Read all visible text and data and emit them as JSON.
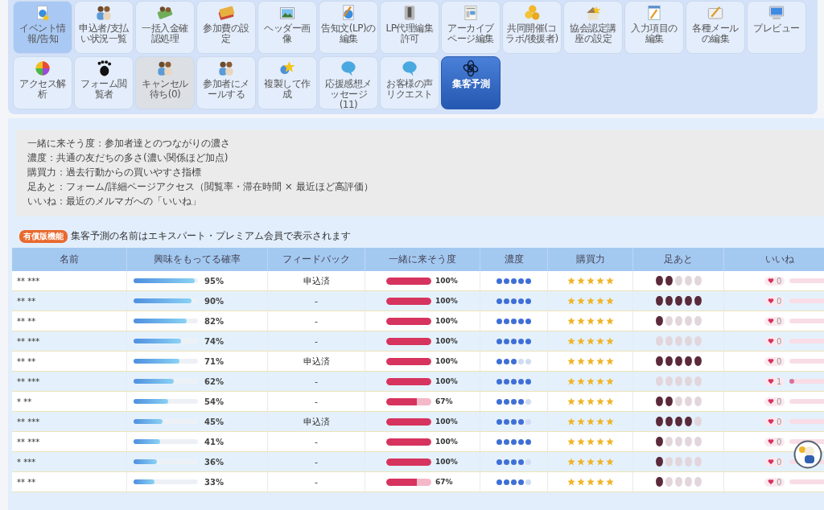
{
  "toolbar": [
    {
      "label": "イベント情報/告知",
      "highlighted": true,
      "selected": false,
      "disabled": false
    },
    {
      "label": "申込者/支払い状況一覧",
      "highlighted": false,
      "selected": false,
      "disabled": false
    },
    {
      "label": "一括入金確認処理",
      "highlighted": false,
      "selected": false,
      "disabled": false
    },
    {
      "label": "参加費の設定",
      "highlighted": false,
      "selected": false,
      "disabled": false
    },
    {
      "label": "ヘッダー画像",
      "highlighted": false,
      "selected": false,
      "disabled": false
    },
    {
      "label": "告知文(LP)の編集",
      "highlighted": false,
      "selected": false,
      "disabled": false
    },
    {
      "label": "LP代理編集許可",
      "highlighted": false,
      "selected": false,
      "disabled": false
    },
    {
      "label": "アーカイブページ編集",
      "highlighted": false,
      "selected": false,
      "disabled": false
    },
    {
      "label": "共同開催(コラボ/後援者)",
      "highlighted": false,
      "selected": false,
      "disabled": false
    },
    {
      "label": "協会認定講座の設定",
      "highlighted": false,
      "selected": false,
      "disabled": false
    },
    {
      "label": "入力項目の編集",
      "highlighted": false,
      "selected": false,
      "disabled": false
    },
    {
      "label": "各種メールの編集",
      "highlighted": false,
      "selected": false,
      "disabled": false
    },
    {
      "label": "プレビュー",
      "highlighted": false,
      "selected": false,
      "disabled": false
    },
    {
      "label": "アクセス解析",
      "highlighted": false,
      "selected": false,
      "disabled": false
    },
    {
      "label": "フォーム閲覧者",
      "highlighted": false,
      "selected": false,
      "disabled": false
    },
    {
      "label": "キャンセル待ち(0)",
      "highlighted": false,
      "selected": false,
      "disabled": true
    },
    {
      "label": "参加者にメールする",
      "highlighted": false,
      "selected": false,
      "disabled": false
    },
    {
      "label": "複製して作成",
      "highlighted": false,
      "selected": false,
      "disabled": false
    },
    {
      "label": "応援感想メッセージ(11)",
      "highlighted": false,
      "selected": false,
      "disabled": false
    },
    {
      "label": "お客様の声リクエスト",
      "highlighted": false,
      "selected": false,
      "disabled": false
    },
    {
      "label": "集客予測",
      "highlighted": false,
      "selected": true,
      "disabled": false
    }
  ],
  "legend": [
    "一緒に来そう度：参加者達とのつながりの濃さ",
    "濃度：共通の友だちの多さ(濃い関係ほど加点)",
    "購買力：過去行動からの買いやすさ指標",
    "足あと：フォーム/詳細ページアクセス（閲覧率・滞在時間 × 最近ほど高評価）",
    "いいね：最近のメルマガへの「いいね」"
  ],
  "notice": {
    "badge": "有償版機能",
    "text": "集客予測の名前はエキスパート・プレミアム会員で表示されます"
  },
  "table": {
    "columns": [
      "名前",
      "興味をもってる確率",
      "フィードバック",
      "一緒に来そう度",
      "濃度",
      "購買力",
      "足あと",
      "いいね"
    ],
    "rows": [
      {
        "name": "** ***",
        "interest": {
          "level": 0.95,
          "text": "95%"
        },
        "feedback": "申込済",
        "together": {
          "level": 1,
          "text": "100%"
        },
        "density": {
          "stars": 5
        },
        "purchase": {
          "stars": 5
        },
        "footprints": {
          "stars": 2
        },
        "likes": {
          "count": "0",
          "level": 0
        }
      },
      {
        "name": "** **",
        "interest": {
          "level": 0.9,
          "text": "90%"
        },
        "feedback": "-",
        "together": {
          "level": 1,
          "text": "100%"
        },
        "density": {
          "stars": 5
        },
        "purchase": {
          "stars": 5
        },
        "footprints": {
          "stars": 5
        },
        "likes": {
          "count": "0",
          "level": 0
        }
      },
      {
        "name": "** **",
        "interest": {
          "level": 0.82,
          "text": "82%"
        },
        "feedback": "-",
        "together": {
          "level": 1,
          "text": "100%"
        },
        "density": {
          "stars": 5
        },
        "purchase": {
          "stars": 5
        },
        "footprints": {
          "stars": 1
        },
        "likes": {
          "count": "0",
          "level": 0
        }
      },
      {
        "name": "** ***",
        "interest": {
          "level": 0.74,
          "text": "74%"
        },
        "feedback": "-",
        "together": {
          "level": 1,
          "text": "100%"
        },
        "density": {
          "stars": 5
        },
        "purchase": {
          "stars": 5
        },
        "footprints": {
          "stars": 0
        },
        "likes": {
          "count": "0",
          "level": 0
        }
      },
      {
        "name": "** **",
        "interest": {
          "level": 0.71,
          "text": "71%"
        },
        "feedback": "申込済",
        "together": {
          "level": 1,
          "text": "100%"
        },
        "density": {
          "stars": 3
        },
        "purchase": {
          "stars": 5
        },
        "footprints": {
          "stars": 5
        },
        "likes": {
          "count": "0",
          "level": 0
        }
      },
      {
        "name": "** ***",
        "interest": {
          "level": 0.62,
          "text": "62%"
        },
        "feedback": "-",
        "together": {
          "level": 1,
          "text": "100%"
        },
        "density": {
          "stars": 5
        },
        "purchase": {
          "stars": 5
        },
        "footprints": {
          "stars": 0
        },
        "likes": {
          "count": "1",
          "level": 0.1
        }
      },
      {
        "name": "* **",
        "interest": {
          "level": 0.54,
          "text": "54%"
        },
        "feedback": "-",
        "together": {
          "level": 0.67,
          "text": "67%"
        },
        "density": {
          "stars": 4
        },
        "purchase": {
          "stars": 5
        },
        "footprints": {
          "stars": 2
        },
        "likes": {
          "count": "0",
          "level": 0
        }
      },
      {
        "name": "** ***",
        "interest": {
          "level": 0.45,
          "text": "45%"
        },
        "feedback": "申込済",
        "together": {
          "level": 1,
          "text": "100%"
        },
        "density": {
          "stars": 4
        },
        "purchase": {
          "stars": 5
        },
        "footprints": {
          "stars": 4
        },
        "likes": {
          "count": "0",
          "level": 0
        }
      },
      {
        "name": "** ***",
        "interest": {
          "level": 0.41,
          "text": "41%"
        },
        "feedback": "-",
        "together": {
          "level": 1,
          "text": "100%"
        },
        "density": {
          "stars": 5
        },
        "purchase": {
          "stars": 5
        },
        "footprints": {
          "stars": 1
        },
        "likes": {
          "count": "0",
          "level": 0
        }
      },
      {
        "name": "* ***",
        "interest": {
          "level": 0.36,
          "text": "36%"
        },
        "feedback": "-",
        "together": {
          "level": 1,
          "text": "100%"
        },
        "density": {
          "stars": 4
        },
        "purchase": {
          "stars": 5
        },
        "footprints": {
          "stars": 1
        },
        "likes": {
          "count": "0",
          "level": 0
        }
      },
      {
        "name": "** **",
        "interest": {
          "level": 0.33,
          "text": "33%"
        },
        "feedback": "-",
        "together": {
          "level": 0.67,
          "text": "67%"
        },
        "density": {
          "stars": 4
        },
        "purchase": {
          "stars": 5
        },
        "footprints": {
          "stars": 1
        },
        "likes": {
          "count": "0",
          "level": 0
        }
      }
    ]
  }
}
